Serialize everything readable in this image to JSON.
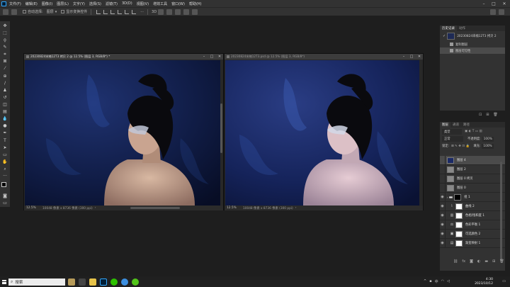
{
  "menu": [
    "文件(F)",
    "编辑(E)",
    "图像(I)",
    "图层(L)",
    "文字(Y)",
    "选择(S)",
    "滤镜(T)",
    "3D(D)",
    "视图(V)",
    "增效工具",
    "窗口(W)",
    "帮助(H)"
  ],
  "options": {
    "auto_select_label": "自动选择:",
    "layer_dropdown": "图层",
    "transform_label": "显示变换控件"
  },
  "doc_left": {
    "title": "20230824宋楠12T3 拷贝 2 @ 12.5% (图层 3, RGB/8*) *",
    "zoom": "12.5%",
    "info": "10048 像素 x 8736 像素 (300 ppi)"
  },
  "doc_right": {
    "title": "20230824宋楠12T3.psd @ 12.5% (图层 3, RGB/8*)",
    "zoom": "12.5%",
    "info": "10048 像素 x 8736 像素 (300 ppi)"
  },
  "history_panel": {
    "tabs": [
      "历史记录",
      "动作"
    ],
    "items": [
      {
        "label": "20230824宋楠12T3 拷贝 2",
        "kind": "snapshot"
      },
      {
        "label": "复制图层",
        "kind": "step"
      },
      {
        "label": "图层可见性",
        "kind": "step"
      }
    ]
  },
  "layers_panel": {
    "tabs": [
      "图层",
      "通道",
      "路径"
    ],
    "kind_dropdown": "类型",
    "mode_dropdown": "正常",
    "opacity_label": "不透明度:",
    "opacity_value": "100%",
    "lock_label": "锁定:",
    "fill_label": "填充:",
    "fill_value": "100%",
    "layers": [
      {
        "name": "图层 4",
        "type": "photo",
        "selected": true
      },
      {
        "name": "图层 2",
        "type": "gray",
        "selected": false
      },
      {
        "name": "图层 0 拷贝",
        "type": "gray",
        "selected": false
      },
      {
        "name": "图层 0",
        "type": "gray",
        "selected": false
      },
      {
        "name": "组 1",
        "type": "group",
        "selected": false
      },
      {
        "name": "曲线 2",
        "type": "adjustment",
        "adj": "curves",
        "selected": false
      },
      {
        "name": "色相/饱和度 1",
        "type": "adjustment",
        "adj": "hue",
        "selected": false
      },
      {
        "name": "色彩平衡 1",
        "type": "adjustment",
        "adj": "balance",
        "selected": false
      },
      {
        "name": "可选颜色 2",
        "type": "adjustment",
        "adj": "selective",
        "selected": false
      },
      {
        "name": "渐变映射 1",
        "type": "adjustment",
        "adj": "gradient",
        "selected": false
      }
    ]
  },
  "taskbar": {
    "search_placeholder": "搜索",
    "time": "4:30",
    "date": "2023/10/12"
  }
}
